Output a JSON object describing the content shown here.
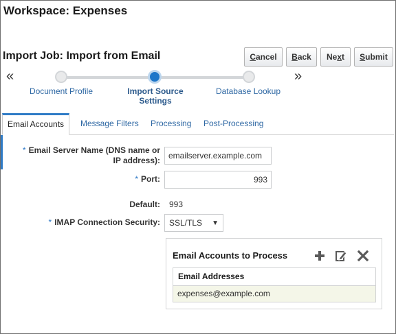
{
  "workspace": {
    "title": "Workspace: Expenses"
  },
  "job": {
    "title": "Import Job: Import from Email"
  },
  "buttons": {
    "cancel": {
      "ul": "C",
      "rest": "ancel"
    },
    "back": {
      "ul": "B",
      "rest": "ack"
    },
    "next": {
      "pre": "Ne",
      "ul": "x",
      "rest": "t"
    },
    "submit": {
      "ul": "S",
      "rest": "ubmit"
    }
  },
  "train": {
    "prev": "«",
    "next": "»",
    "stops": [
      {
        "label": "Document Profile",
        "state": "visited"
      },
      {
        "label": "Import Source Settings",
        "line1": "Import Source",
        "line2": "Settings",
        "state": "current"
      },
      {
        "label": "Database Lookup",
        "state": "unvisited"
      }
    ]
  },
  "tabs": [
    {
      "label": "Email Accounts",
      "active": true
    },
    {
      "label": "Message Filters"
    },
    {
      "label": "Processing"
    },
    {
      "label": "Post-Processing"
    }
  ],
  "form": {
    "required_mark": "*",
    "server": {
      "label_line1": "Email Server Name (DNS name or",
      "label_line2": "IP address):",
      "value": "emailserver.example.com"
    },
    "port": {
      "label": "Port:",
      "value": "993"
    },
    "default": {
      "label": "Default:",
      "value": "993"
    },
    "security": {
      "label": "IMAP Connection Security:",
      "value": "SSL/TLS",
      "arrow": "▼"
    }
  },
  "accounts_panel": {
    "title": "Email Accounts to Process",
    "column": "Email Addresses",
    "rows": [
      "expenses@example.com"
    ],
    "icons": [
      "add-icon",
      "edit-icon",
      "delete-icon"
    ]
  },
  "colors": {
    "accent": "#2f7bc6",
    "link": "#2d67a3",
    "selected_row": "#f4f6e8"
  }
}
